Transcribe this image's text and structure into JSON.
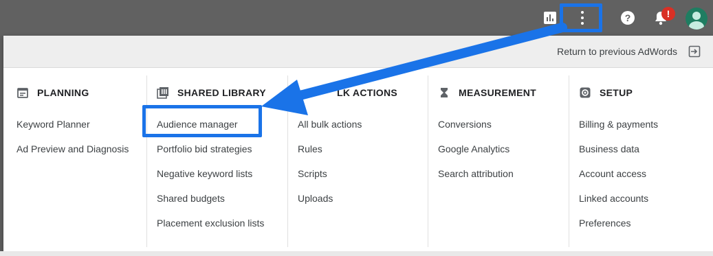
{
  "header": {
    "return_label": "Return to previous AdWords",
    "notification_badge": "!"
  },
  "columns": [
    {
      "title": "PLANNING",
      "icon": "calendar-icon",
      "items": [
        "Keyword Planner",
        "Ad Preview and Diagnosis"
      ]
    },
    {
      "title": "SHARED LIBRARY",
      "icon": "library-icon",
      "items": [
        "Audience manager",
        "Portfolio bid strategies",
        "Negative keyword lists",
        "Shared budgets",
        "Placement exclusion lists"
      ]
    },
    {
      "title": "BULK ACTIONS",
      "title_visible": "LK ACTIONS",
      "icon": "bulk-actions-icon",
      "items": [
        "All bulk actions",
        "Rules",
        "Scripts",
        "Uploads"
      ]
    },
    {
      "title": "MEASUREMENT",
      "icon": "hourglass-icon",
      "items": [
        "Conversions",
        "Google Analytics",
        "Search attribution"
      ]
    },
    {
      "title": "SETUP",
      "icon": "settings-icon",
      "items": [
        "Billing & payments",
        "Business data",
        "Account access",
        "Linked accounts",
        "Preferences"
      ]
    }
  ],
  "colors": {
    "highlight": "#1a73e8",
    "topbar": "#616161",
    "badge": "#d93025"
  }
}
